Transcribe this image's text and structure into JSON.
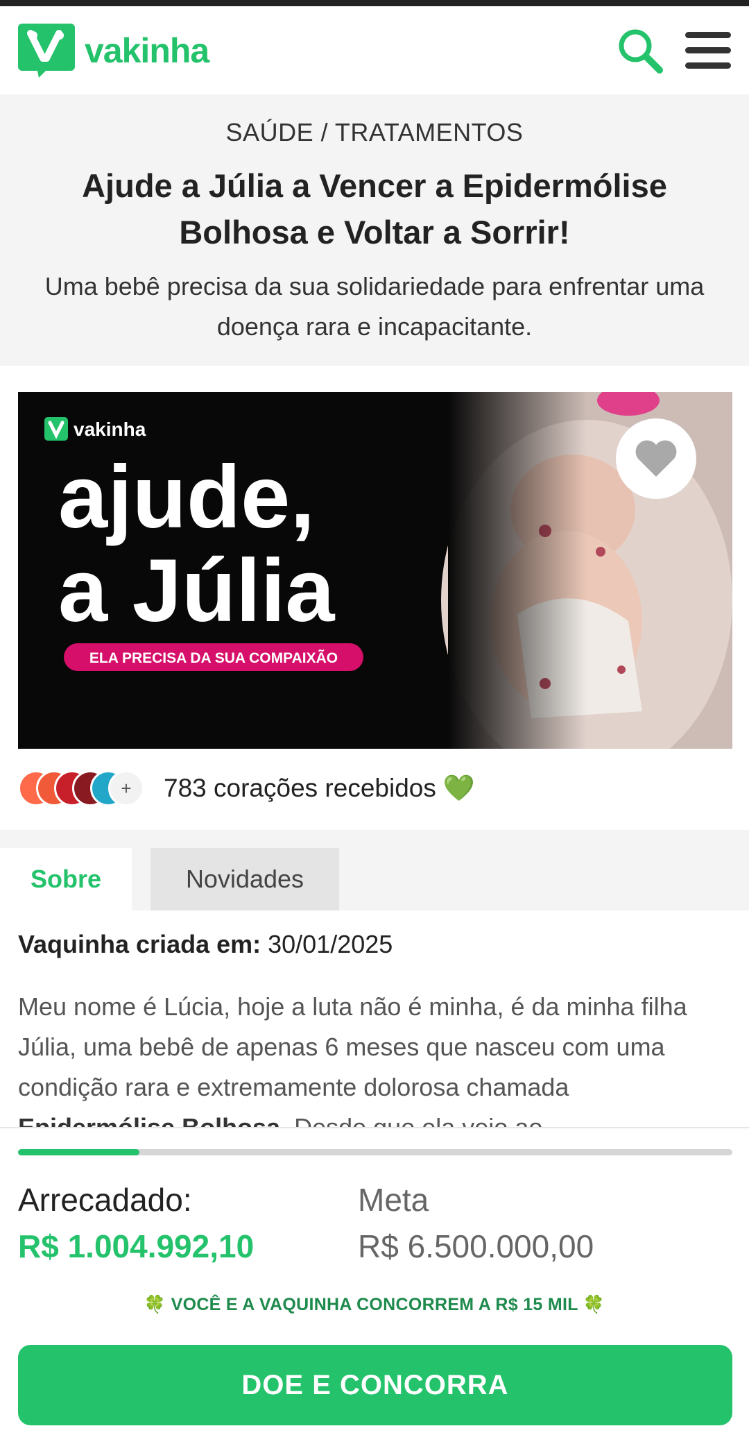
{
  "header": {
    "logo_text": "vakinha",
    "brand_color": "#23c26b",
    "icons": [
      "search-icon",
      "menu-icon"
    ]
  },
  "campaign": {
    "category": "SAÚDE / TRATAMENTOS",
    "title": "Ajude a Júlia a Vencer a Epidermólise Bolhosa e Voltar a Sorrir!",
    "subtitle": "Uma bebê precisa da sua solidariedade para enfrentar uma doença rara e incapacitante."
  },
  "banner": {
    "logo_text": "vakinha",
    "headline_line1": "ajude,",
    "headline_line2": "a Júlia",
    "tagline": "ELA PRECISA DA SUA COMPAIXÃO",
    "favorite_icon": "heart-icon"
  },
  "hearts": {
    "more_label": "+",
    "text": "783 corações recebidos",
    "emoji": "💚"
  },
  "tabs": [
    {
      "label": "Sobre",
      "active": true
    },
    {
      "label": "Novidades",
      "active": false
    }
  ],
  "details": {
    "created_label": "Vaquinha criada em:",
    "created_date": "30/01/2025",
    "story_part1": "Meu nome é Lúcia, hoje a luta não é minha, é da minha filha Júlia, uma bebê de apenas 6 meses que nasceu com uma condição rara e extremamente dolorosa chamada ",
    "story_bold": "Epidermólise Bolhosa",
    "story_part2": ". Desde que ela veio ao"
  },
  "donation": {
    "raised_label": "Arrecadado:",
    "raised_value": "R$ 1.004.992,10",
    "goal_label": "Meta",
    "goal_value": "R$ 6.500.000,00",
    "progress_fraction": 0.17,
    "promo_text": "VOCÊ E A VAQUINHA CONCORREM A R$ 15 MIL",
    "promo_emoji": "🍀",
    "cta_label": "DOE E CONCORRA"
  }
}
